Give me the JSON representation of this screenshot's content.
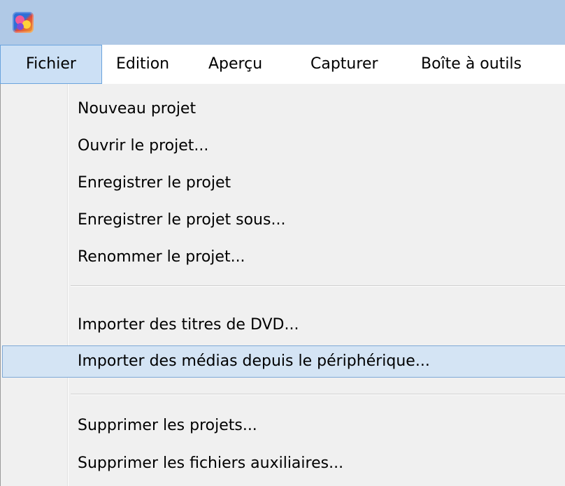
{
  "menubar": {
    "items": [
      {
        "label": "Fichier",
        "active": true
      },
      {
        "label": "Edition",
        "active": false
      },
      {
        "label": "Aperçu",
        "active": false
      },
      {
        "label": "Capturer",
        "active": false
      },
      {
        "label": "Boîte à outils",
        "active": false
      }
    ]
  },
  "menu": {
    "items": [
      {
        "label": "Nouveau projet"
      },
      {
        "label": "Ouvrir le projet..."
      },
      {
        "label": "Enregistrer le projet"
      },
      {
        "label": "Enregistrer le projet sous..."
      },
      {
        "label": "Renommer le projet..."
      },
      {
        "label": "Importer des titres de DVD..."
      },
      {
        "label": "Importer des médias depuis le périphérique...",
        "highlighted": true
      },
      {
        "label": "Supprimer les projets..."
      },
      {
        "label": "Supprimer les fichiers auxiliaires..."
      }
    ]
  },
  "colors": {
    "titlebar": "#b0c9e6",
    "menubar_active": "#cce0f5",
    "item_highlight": "#d4e4f4",
    "menu_background": "#f0f0f0"
  },
  "icons": {
    "app": "app-logo-icon"
  }
}
